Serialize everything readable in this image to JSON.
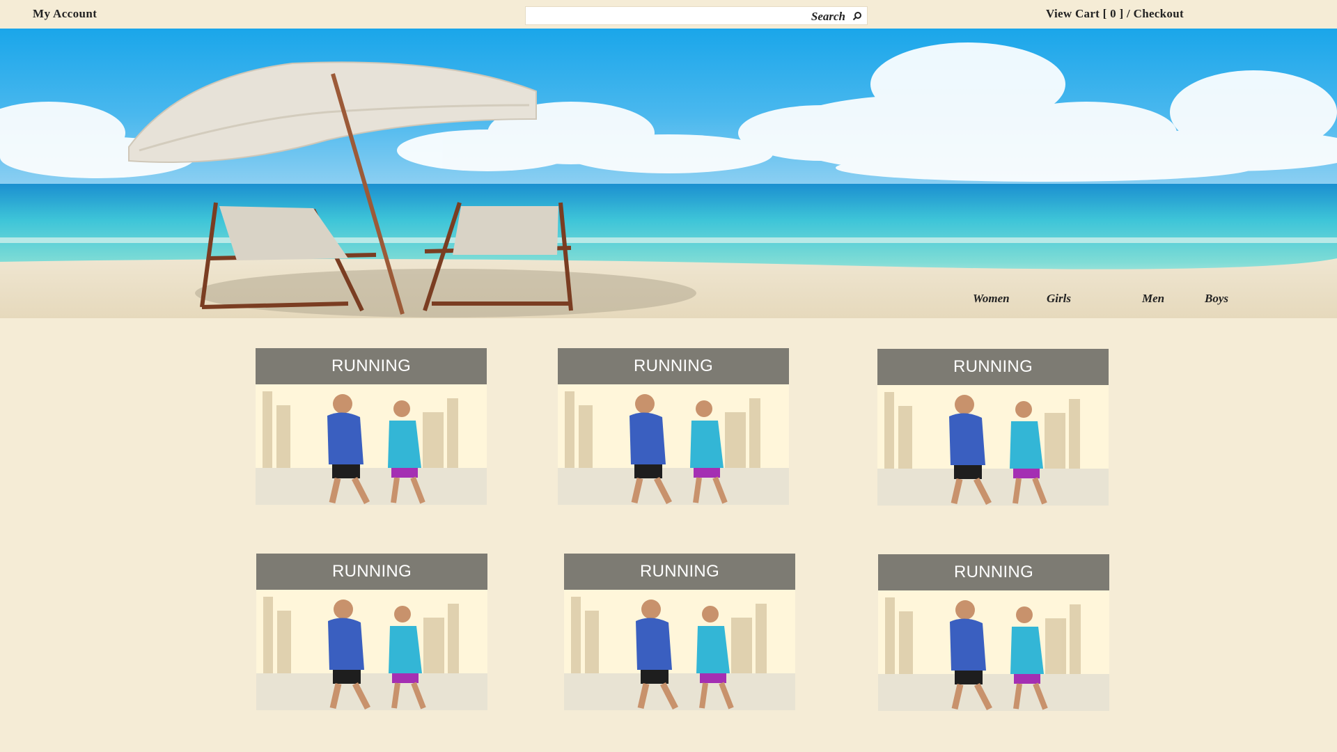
{
  "header": {
    "account_label": "My Account",
    "search_placeholder": "Search",
    "cart_label": "View Cart [ 0 ]",
    "separator": " / ",
    "checkout_label": "Checkout"
  },
  "nav": {
    "items": [
      {
        "label": "Women"
      },
      {
        "label": "Girls"
      },
      {
        "label": "Men"
      },
      {
        "label": "Boys"
      }
    ]
  },
  "products": [
    {
      "title": "RUNNING"
    },
    {
      "title": "RUNNING"
    },
    {
      "title": "RUNNING"
    },
    {
      "title": "RUNNING"
    },
    {
      "title": "RUNNING"
    },
    {
      "title": "RUNNING"
    }
  ]
}
